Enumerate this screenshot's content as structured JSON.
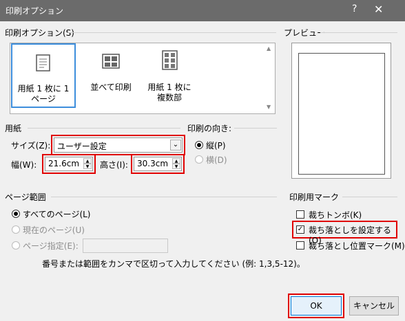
{
  "window": {
    "title": "印刷オプション",
    "help": "?",
    "close": "✕"
  },
  "print_options": {
    "label": "印刷オプション(S)",
    "items": [
      {
        "label": "用紙 1 枚に 1 ページ",
        "icon": "single-page-icon"
      },
      {
        "label": "並べて印刷",
        "icon": "tiled-pages-icon"
      },
      {
        "label": "用紙 1 枚に複数部",
        "icon": "multiple-copies-icon"
      }
    ]
  },
  "preview": {
    "label": "プレビュー"
  },
  "paper": {
    "label": "用紙",
    "size_label": "サイズ(Z):",
    "size_value": "ユーザー設定",
    "width_label": "幅(W):",
    "width_value": "21.6cm",
    "height_label": "高さ(I):",
    "height_value": "30.3cm"
  },
  "orientation": {
    "label": "印刷の向き:",
    "portrait": "縦(P)",
    "landscape": "横(D)"
  },
  "page_range": {
    "label": "ページ範囲",
    "all": "すべてのページ(L)",
    "current": "現在のページ(U)",
    "specify": "ページ指定(E):",
    "specify_value": "",
    "hint": "番号または範囲をカンマで区切って入力してください (例: 1,3,5-12)。"
  },
  "print_marks": {
    "label": "印刷用マーク",
    "crop_marks": "裁ちトンボ(K)",
    "bleed": "裁ち落としを設定する(O)",
    "bleed_marks": "裁ち落とし位置マーク(M)",
    "crop_marks_checked": false,
    "bleed_checked": true,
    "bleed_marks_checked": false
  },
  "buttons": {
    "ok": "OK",
    "cancel": "キャンセル"
  }
}
